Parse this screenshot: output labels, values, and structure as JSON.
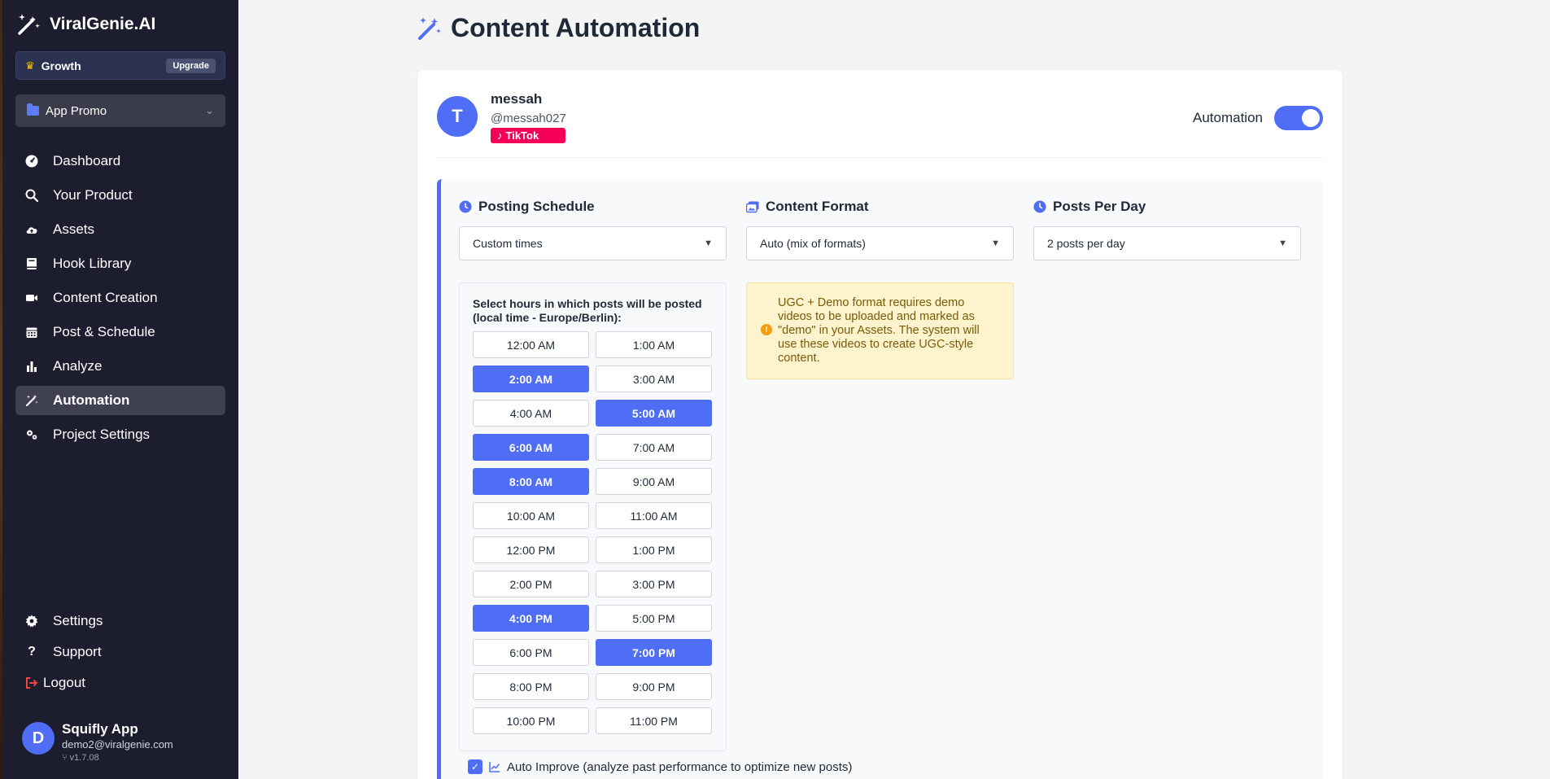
{
  "brand": {
    "name": "ViralGenie.AI"
  },
  "plan": {
    "label": "Growth",
    "upgrade_label": "Upgrade"
  },
  "project": {
    "label": "App Promo"
  },
  "nav": [
    {
      "id": "dashboard",
      "label": "Dashboard",
      "icon": "gauge-icon"
    },
    {
      "id": "your-product",
      "label": "Your Product",
      "icon": "search-icon"
    },
    {
      "id": "assets",
      "label": "Assets",
      "icon": "cloud-upload-icon"
    },
    {
      "id": "hook-library",
      "label": "Hook Library",
      "icon": "book-icon"
    },
    {
      "id": "content-creation",
      "label": "Content Creation",
      "icon": "video-icon"
    },
    {
      "id": "post-schedule",
      "label": "Post & Schedule",
      "icon": "calendar-icon"
    },
    {
      "id": "analyze",
      "label": "Analyze",
      "icon": "bar-chart-icon"
    },
    {
      "id": "automation",
      "label": "Automation",
      "icon": "magic-wand-icon"
    },
    {
      "id": "project-settings",
      "label": "Project Settings",
      "icon": "gears-icon"
    }
  ],
  "bottom_nav": {
    "settings": "Settings",
    "support": "Support",
    "logout": "Logout"
  },
  "user": {
    "initial": "D",
    "name": "Squifly App",
    "email": "demo2@viralgenie.com",
    "version": "v1.7.08"
  },
  "page": {
    "title": "Content Automation"
  },
  "account": {
    "initial": "T",
    "name": "messah",
    "handle": "@messah027",
    "platform": "TikTok",
    "automation_label": "Automation",
    "automation_on": true
  },
  "schedule": {
    "title": "Posting Schedule",
    "value": "Custom times"
  },
  "format": {
    "title": "Content Format",
    "value": "Auto (mix of formats)"
  },
  "per_day": {
    "title": "Posts Per Day",
    "value": "2 posts per day"
  },
  "hours": {
    "title": "Select hours in which posts will be posted (local time - Europe/Berlin):",
    "slots": [
      {
        "label": "12:00 AM",
        "on": false
      },
      {
        "label": "1:00 AM",
        "on": false
      },
      {
        "label": "2:00 AM",
        "on": true
      },
      {
        "label": "3:00 AM",
        "on": false
      },
      {
        "label": "4:00 AM",
        "on": false
      },
      {
        "label": "5:00 AM",
        "on": true
      },
      {
        "label": "6:00 AM",
        "on": true
      },
      {
        "label": "7:00 AM",
        "on": false
      },
      {
        "label": "8:00 AM",
        "on": true
      },
      {
        "label": "9:00 AM",
        "on": false
      },
      {
        "label": "10:00 AM",
        "on": false
      },
      {
        "label": "11:00 AM",
        "on": false
      },
      {
        "label": "12:00 PM",
        "on": false
      },
      {
        "label": "1:00 PM",
        "on": false
      },
      {
        "label": "2:00 PM",
        "on": false
      },
      {
        "label": "3:00 PM",
        "on": false
      },
      {
        "label": "4:00 PM",
        "on": true
      },
      {
        "label": "5:00 PM",
        "on": false
      },
      {
        "label": "6:00 PM",
        "on": false
      },
      {
        "label": "7:00 PM",
        "on": true
      },
      {
        "label": "8:00 PM",
        "on": false
      },
      {
        "label": "9:00 PM",
        "on": false
      },
      {
        "label": "10:00 PM",
        "on": false
      },
      {
        "label": "11:00 PM",
        "on": false
      }
    ]
  },
  "notice": {
    "text": "UGC + Demo format requires demo videos to be uploaded and marked as \"demo\" in your Assets. The system will use these videos to create UGC-style content."
  },
  "auto_improve": {
    "label": "Auto Improve (analyze past performance to optimize new posts)",
    "checked": true
  },
  "colors": {
    "accent": "#4f6df5",
    "sidebar": "#1c1d2e",
    "tiktok": "#f50057",
    "notice_bg": "#fdf3cc"
  }
}
